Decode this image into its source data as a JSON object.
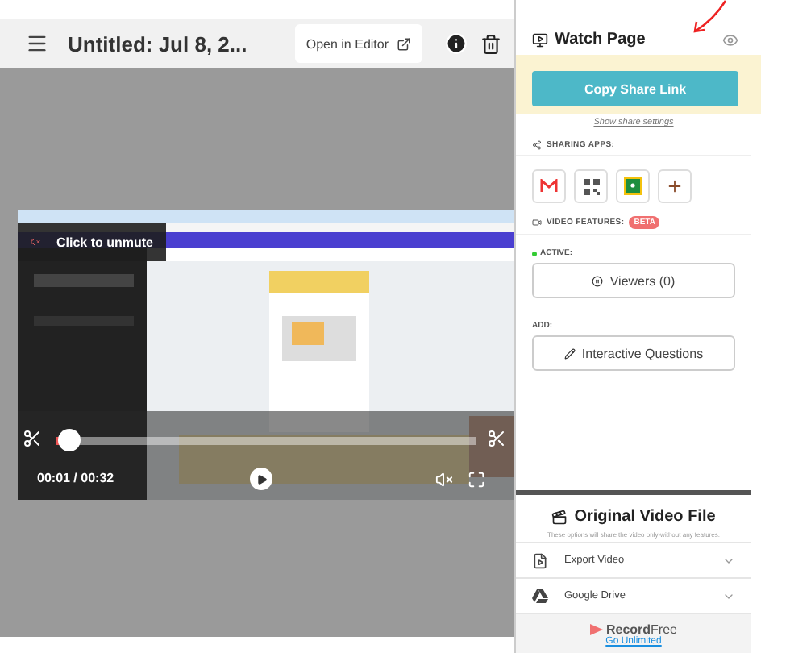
{
  "header": {
    "title": "Untitled: Jul 8, 2...",
    "open_button": "Open in Editor"
  },
  "player": {
    "unmute": "Click to unmute",
    "level": 0.03,
    "time": "00:01 / 00:32"
  },
  "panel": {
    "title": "Watch Page",
    "copy_button": "Copy Share Link",
    "share_settings": "Show share settings",
    "sharing_apps_label": "SHARING APPS:",
    "apps": [
      {
        "kind": "mail"
      },
      {
        "kind": "qr"
      },
      {
        "kind": "classroom"
      },
      {
        "kind": "more"
      }
    ]
  },
  "video_features": {
    "label": "VIDEO FEATURES:",
    "badge": "BETA",
    "active_label": "ACTIVE:",
    "active": [
      {
        "kind": "viewers",
        "label": "Viewers (0)"
      }
    ],
    "add_label": "ADD:",
    "add": [
      {
        "kind": "questions",
        "label": "Interactive Questions"
      }
    ]
  },
  "original": {
    "title": "Original Video File",
    "subtitle": "These options will share the video only-without any features.",
    "options": [
      {
        "kind": "export",
        "label": "Export Video"
      },
      {
        "kind": "drive",
        "label": "Google Drive"
      }
    ]
  },
  "footer": {
    "brand": "**Record**Free",
    "link": "Go Unlimited"
  }
}
